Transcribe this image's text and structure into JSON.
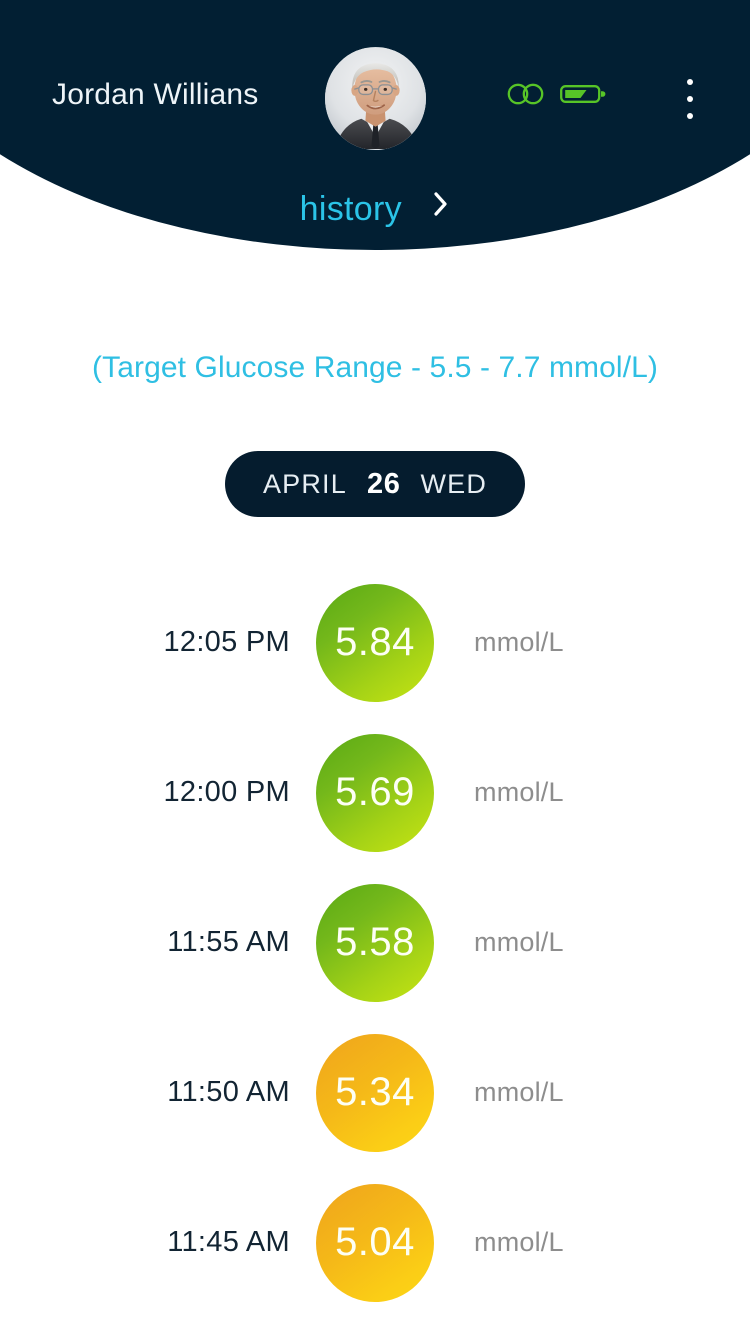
{
  "header": {
    "user_name": "Jordan Willians",
    "avatar_alt": "user-avatar",
    "icons": {
      "connection": "infinity-icon",
      "battery": "battery-icon",
      "menu": "overflow-menu-icon"
    },
    "history_label": "history",
    "history_chevron": "chevron-right-icon",
    "bg_color": "#021f33",
    "accent_cyan": "#2bc4e8",
    "accent_green": "#5fc127"
  },
  "target_range": {
    "text": "(Target Glucose Range - 5.5 - 7.7 mmol/L)",
    "low": "5.5",
    "high": "7.7",
    "unit": "mmol/L",
    "color": "#2fbfe3"
  },
  "date_selector": {
    "month": "APRIL",
    "day": "26",
    "weekday": "WED",
    "bg_color": "#051c2e"
  },
  "readings": {
    "unit": "mmol/L",
    "items": [
      {
        "time": "12:05 PM",
        "value": "5.84",
        "unit": "mmol/L",
        "tone": "green"
      },
      {
        "time": "12:00 PM",
        "value": "5.69",
        "unit": "mmol/L",
        "tone": "green"
      },
      {
        "time": "11:55 AM",
        "value": "5.58",
        "unit": "mmol/L",
        "tone": "green"
      },
      {
        "time": "11:50 AM",
        "value": "5.34",
        "unit": "mmol/L",
        "tone": "orange"
      },
      {
        "time": "11:45 AM",
        "value": "5.04",
        "unit": "mmol/L",
        "tone": "orange"
      }
    ]
  },
  "colors": {
    "green_start": "#59a914",
    "green_end": "#c8e513",
    "orange_start": "#efa41d",
    "orange_end": "#fcd717",
    "time_text": "#122433",
    "unit_text": "#8d8d8d",
    "page_bg": "#ffffff"
  }
}
